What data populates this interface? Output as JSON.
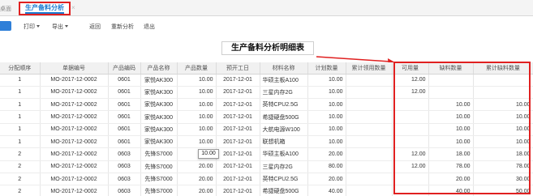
{
  "tabs": {
    "prev_label": "桌面",
    "active_label": "生产备料分析",
    "close_glyph": "×"
  },
  "toolbar": {
    "print_label": "打印",
    "export_label": "导出",
    "back_label": "返回",
    "reanalyze_label": "重新分析",
    "exit_label": "退出"
  },
  "report": {
    "title": "生产备料分析明细表"
  },
  "table": {
    "columns": [
      "分配顺序",
      "单据编号",
      "产品编码",
      "产品名称",
      "产品数量",
      "预开工日",
      "材料名称",
      "计划数量",
      "累计领用数量",
      "可用量",
      "缺料数量",
      "累计缺料数量"
    ],
    "rows": [
      [
        "1",
        "MO-2017-12-0002",
        "0601",
        "家悦AK300",
        "10.00",
        "2017-12-01",
        "华硕主板A100",
        "10.00",
        "",
        "12.00",
        "",
        ""
      ],
      [
        "1",
        "MO-2017-12-0002",
        "0601",
        "家悦AK300",
        "10.00",
        "2017-12-01",
        "三星内存2G",
        "10.00",
        "",
        "12.00",
        "",
        ""
      ],
      [
        "1",
        "MO-2017-12-0002",
        "0601",
        "家悦AK300",
        "10.00",
        "2017-12-01",
        "英特CPU2.5G",
        "10.00",
        "",
        "",
        "10.00",
        "10.00"
      ],
      [
        "1",
        "MO-2017-12-0002",
        "0601",
        "家悦AK300",
        "10.00",
        "2017-12-01",
        "希捷硬盘500G",
        "10.00",
        "",
        "",
        "10.00",
        "10.00"
      ],
      [
        "1",
        "MO-2017-12-0002",
        "0601",
        "家悦AK300",
        "10.00",
        "2017-12-01",
        "大航电源W100",
        "10.00",
        "",
        "",
        "10.00",
        "10.00"
      ],
      [
        "1",
        "MO-2017-12-0002",
        "0601",
        "家悦AK300",
        "10.00",
        "2017-12-01",
        "联想机箱",
        "10.00",
        "",
        "",
        "10.00",
        "10.00"
      ],
      [
        "2",
        "MO-2017-12-0002",
        "0603",
        "先锋S7000",
        "20.00",
        "2017-12-01",
        "华硕主板A100",
        "20.00",
        "",
        "12.00",
        "18.00",
        "18.00"
      ],
      [
        "2",
        "MO-2017-12-0002",
        "0603",
        "先锋S7000",
        "20.00",
        "2017-12-01",
        "三星内存2G",
        "80.00",
        "",
        "12.00",
        "78.00",
        "78.00"
      ],
      [
        "2",
        "MO-2017-12-0002",
        "0603",
        "先锋S7000",
        "20.00",
        "2017-12-01",
        "英特CPU2.5G",
        "20.00",
        "",
        "",
        "20.00",
        "30.00"
      ],
      [
        "2",
        "MO-2017-12-0002",
        "0603",
        "先锋S7000",
        "20.00",
        "2017-12-01",
        "希捷硬盘500G",
        "40.00",
        "",
        "",
        "40.00",
        "50.00"
      ]
    ]
  },
  "tooltip": {
    "value": "10.00"
  },
  "colors": {
    "highlight": "#e02020",
    "accent": "#1a7ad0",
    "primary_button": "#2f7fd8"
  }
}
